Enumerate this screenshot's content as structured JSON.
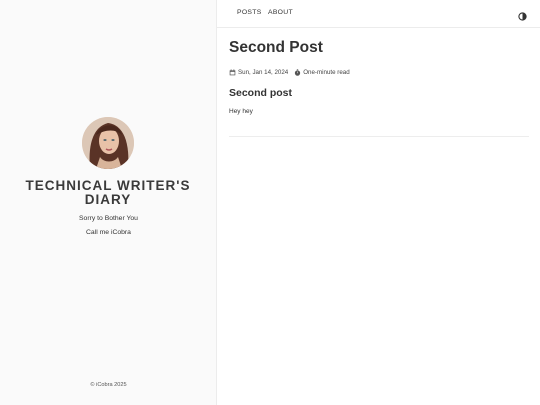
{
  "sidebar": {
    "site_title": "TECHNICAL WRITER'S DIARY",
    "tagline_1": "Sorry to Bother You",
    "tagline_2": "Call me iCobra",
    "footer": "© iCobra 2025"
  },
  "nav": {
    "posts_label": "POSTS",
    "about_label": "ABOUT",
    "theme_icon": "theme-toggle-icon"
  },
  "post": {
    "title": "Second Post",
    "date": "Sun, Jan 14, 2024",
    "read_time": "One-minute read",
    "heading": "Second post",
    "body": "Hey hey"
  },
  "colors": {
    "sidebar_bg": "#fafafa",
    "text": "#333333",
    "divider": "#ececec"
  }
}
